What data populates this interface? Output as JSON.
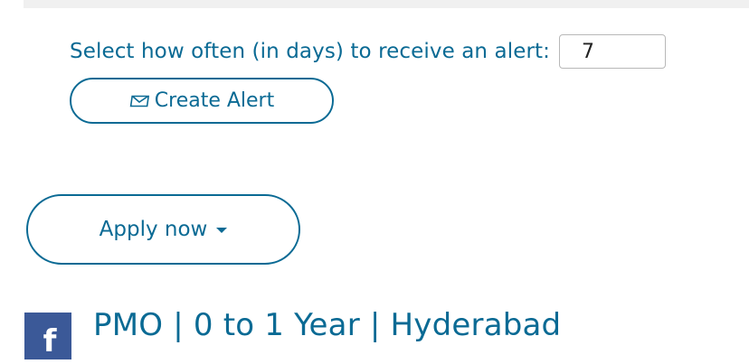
{
  "alert": {
    "label": "Select how often (in days) to receive an alert:",
    "days_value": "7",
    "create_button_label": "Create Alert",
    "create_button_icon": "envelope-icon"
  },
  "apply": {
    "label": "Apply now",
    "icon": "caret-down-icon"
  },
  "share": {
    "facebook_glyph": "f"
  },
  "job": {
    "title": "PMO | 0 to 1 Year | Hyderabad"
  },
  "colors": {
    "accent": "#0a6a94",
    "facebook": "#3b5998",
    "band": "#f0f0f0"
  }
}
